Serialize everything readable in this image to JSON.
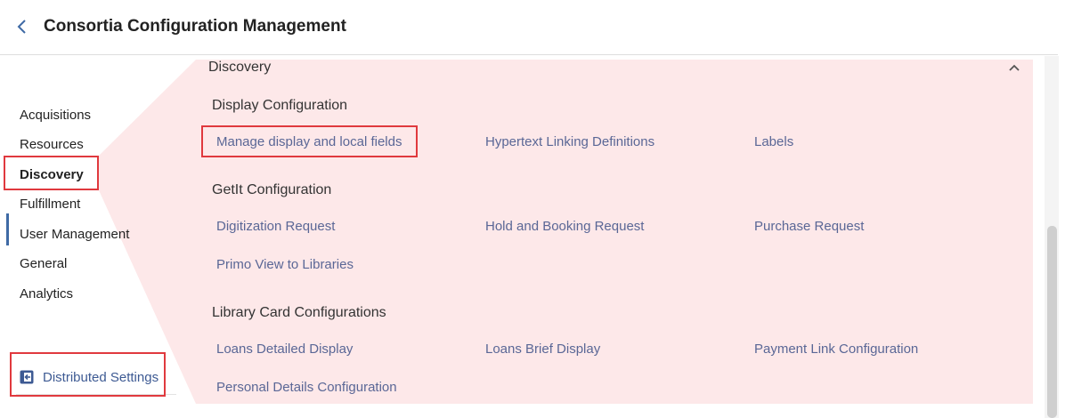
{
  "header": {
    "title": "Consortia Configuration Management",
    "back_icon": "chevron-left-icon"
  },
  "sidebar": {
    "items": [
      {
        "label": "Acquisitions"
      },
      {
        "label": "Resources"
      },
      {
        "label": "Discovery",
        "active": true
      },
      {
        "label": "Fulfillment"
      },
      {
        "label": "User Management"
      },
      {
        "label": "General"
      },
      {
        "label": "Analytics"
      }
    ],
    "distributed_settings": {
      "label": "Distributed Settings",
      "icon": "exit-box-icon"
    }
  },
  "panel": {
    "title": "Discovery",
    "collapse_icon": "chevron-up-icon",
    "sections": [
      {
        "title": "Display Configuration",
        "links": [
          "Manage display and local fields",
          "Hypertext Linking Definitions",
          "Labels"
        ]
      },
      {
        "title": "GetIt Configuration",
        "links": [
          "Digitization Request",
          "Hold and Booking Request",
          "Purchase Request",
          "Primo View to Libraries"
        ]
      },
      {
        "title": "Library Card Configurations",
        "links": [
          "Loans Detailed Display",
          "Loans Brief Display",
          "Payment Link Configuration",
          "Personal Details Configuration"
        ]
      }
    ]
  },
  "colors": {
    "highlight_border": "#e0393e",
    "highlight_fill": "#fde8e9",
    "link": "#5a6796",
    "accent": "#3f6aa5"
  }
}
